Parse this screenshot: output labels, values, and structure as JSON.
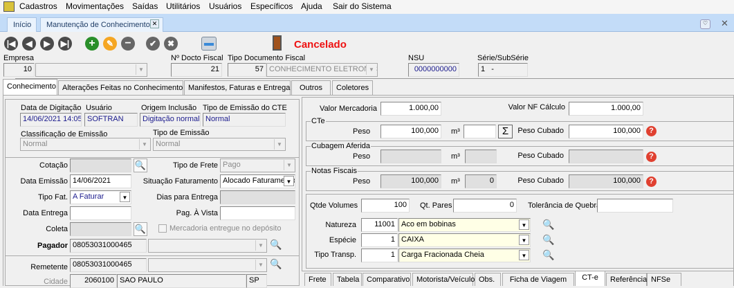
{
  "menu": [
    "Cadastros",
    "Movimentações",
    "Saídas",
    "Utilitários",
    "Usuários",
    "Específicos",
    "Ajuda",
    "Sair do Sistema"
  ],
  "doc_tabs": {
    "home": "Início",
    "active": "Manutenção de Conhecimentos"
  },
  "status": "Cancelado",
  "header": {
    "empresa_label": "Empresa",
    "empresa_code": "10",
    "empresa_name": "",
    "docto_label": "Nº Docto Fiscal",
    "docto_value": "21",
    "tipo_doc_label": "Tipo Documento Fiscal",
    "tipo_doc_code": "57",
    "tipo_doc_name": "CONHECIMENTO ELETRONICO",
    "nsu_label": "NSU",
    "nsu_value": "0000000000",
    "serie_label": "Série/SubSérie",
    "serie_value": "1   -"
  },
  "tabs": [
    "Conhecimento",
    "Alterações Feitas no Conhecimento",
    "Manifestos, Faturas e Entrega",
    "Outros",
    "Coletores"
  ],
  "left": {
    "data_dig_label": "Data de Digitação",
    "data_dig": "14/06/2021 14:05",
    "usuario_label": "Usuário",
    "usuario": "SOFTRAN",
    "origem_label": "Origem Inclusão",
    "origem": "Digitação normal",
    "tipo_emissao_cte_label": "Tipo de Emissão do CTE",
    "tipo_emissao_cte": "Normal",
    "classif_label": "Classificação de Emissão",
    "classif": "Normal",
    "tipo_emissao_label": "Tipo de Emissão",
    "tipo_emissao": "Normal",
    "cotacao_label": "Cotação",
    "cotacao": "",
    "tipo_frete_label": "Tipo de Frete",
    "tipo_frete": "Pago",
    "data_emissao_label": "Data Emissão",
    "data_emissao": "14/06/2021",
    "sit_fat_label": "Situação Faturamento",
    "sit_fat": "Alocado Faturamento",
    "tipo_fat_label": "Tipo Fat.",
    "tipo_fat": "A Faturar",
    "dias_label": "Dias para Entrega",
    "dias": "",
    "data_entrega_label": "Data Entrega",
    "data_entrega": "",
    "pag_vista_label": "Pag. À Vista",
    "pag_vista": "",
    "coleta_label": "Coleta",
    "coleta": "",
    "merc_label": "Mercadoria entregue no depósito",
    "pagador_label": "Pagador",
    "pagador": "08053031000465",
    "remetente_label": "Remetente",
    "remetente": "08053031000465",
    "cidade_label": "Cidade",
    "cidade_code": "2060100",
    "cidade_name": "SAO PAULO",
    "uf": "SP"
  },
  "right": {
    "valor_merc_label": "Valor Mercadoria",
    "valor_merc": "1.000,00",
    "valor_nf_label": "Valor NF Cálculo",
    "valor_nf": "1.000,00",
    "peso_label": "Peso",
    "m3_label": "m³",
    "peso_cubado_label": "Peso Cubado",
    "cte": {
      "title": "CTe",
      "peso": "100,000",
      "m3": "",
      "peso_cubado": "100,000"
    },
    "cubagem": {
      "title": "Cubagem Aferida",
      "peso": "",
      "m3": "",
      "peso_cubado": ""
    },
    "nf": {
      "title": "Notas Fiscais",
      "peso": "100,000",
      "m3": "0",
      "peso_cubado": "100,000"
    },
    "qtde_vol_label": "Qtde Volumes",
    "qtde_vol": "100",
    "qt_pares_label": "Qt. Pares",
    "qt_pares": "0",
    "tolerancia_label": "Tolerância de Quebra",
    "tolerancia": "",
    "natureza_label": "Natureza",
    "natureza_code": "11001",
    "natureza": "Aco em bobinas",
    "especie_label": "Espécie",
    "especie_code": "1",
    "especie": "CAIXA",
    "tipo_transp_label": "Tipo Transp.",
    "tipo_transp_code": "1",
    "tipo_transp": "Carga Fracionada Cheia"
  },
  "bottom_tabs": [
    "Frete",
    "Tabela",
    "Comparativo",
    "Motorista/Veículo",
    "Obs.",
    "Ficha de Viagem",
    "CT-e",
    "Referência",
    "NFSe"
  ],
  "colors": {
    "status": "#ee1111",
    "tabstrip": "#c3dcf8",
    "help": "#e04030",
    "highlight": "#ffffe6"
  }
}
